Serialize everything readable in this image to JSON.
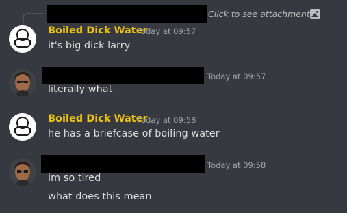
{
  "colors": {
    "background": "#36393f",
    "username": "#f1c40f",
    "message_text": "#dcddde",
    "timestamp": "#a3a6aa",
    "redaction": "#000000"
  },
  "reply": {
    "attachment_text": "Click to see attachment",
    "icon": "image-icon"
  },
  "messages": [
    {
      "author": "Boiled Dick Water",
      "avatar": "bot-avatar",
      "timestamp": "Today at 09:57",
      "lines": [
        "it's big dick larry"
      ]
    },
    {
      "author": "",
      "avatar": "photo-avatar",
      "timestamp": "Today at 09:57",
      "lines": [
        "literally what"
      ]
    },
    {
      "author": "Boiled Dick Water",
      "avatar": "bot-avatar",
      "timestamp": "Today at 09:58",
      "lines": [
        "he has a briefcase of boiling water"
      ]
    },
    {
      "author": "",
      "avatar": "photo-avatar",
      "timestamp": "Today at 09:58",
      "lines": [
        "im so tired",
        "what does this mean"
      ]
    }
  ]
}
